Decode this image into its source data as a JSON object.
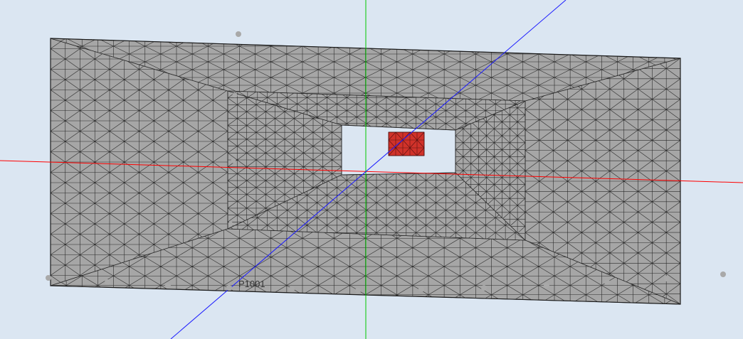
{
  "viewport": {
    "background": "#dbe6f2",
    "mesh_fill": "#a6a6a6",
    "mesh_line": "#2b2b2b",
    "highlight_fill": "#d0322a",
    "axis_colors": {
      "x": "#ff0000",
      "y": "#00c800",
      "z": "#1a1aff"
    },
    "point_color": "#a9a9a9"
  },
  "annotations": {
    "point_label": "P1001"
  }
}
